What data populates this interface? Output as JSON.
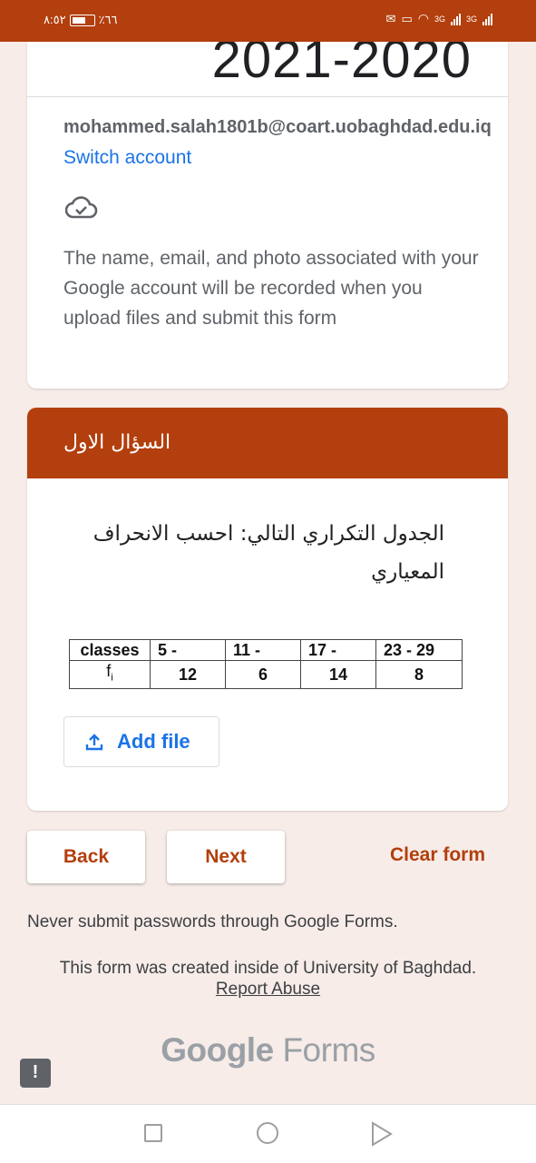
{
  "status_bar": {
    "time": "٨:٥٢",
    "battery_percent": "٪٦٦",
    "network_label_1": "3G",
    "network_label_2": "3G"
  },
  "header_card": {
    "year_title": "2021-2020",
    "account_email": "mohammed.salah1801b@coart.uobaghdad.edu.iq",
    "switch_account": "Switch account",
    "notice": "The name, email, and photo associated with your Google account will be recorded when you upload files and submit this form"
  },
  "question_card": {
    "section_title": "السؤال الاول",
    "question_text": "الجدول التكراري التالي: احسب الانحراف المعياري",
    "table": {
      "row1": [
        "classes",
        "5 -",
        "11 -",
        "17 -",
        "23 - 29"
      ],
      "row2_label": "f",
      "row2_sub": "i",
      "row2": [
        "12",
        "6",
        "14",
        "8"
      ]
    },
    "add_file_label": "Add file"
  },
  "actions": {
    "back": "Back",
    "next": "Next",
    "clear": "Clear form"
  },
  "footer": {
    "password_note": "Never submit passwords through Google Forms.",
    "created_note": "This form was created inside of University of Baghdad.",
    "report_abuse": "Report Abuse",
    "brand_google": "Google",
    "brand_forms": "Forms"
  },
  "colors": {
    "theme": "#b23f0d",
    "background": "#f7ece8",
    "link": "#1a73e8"
  },
  "icons": [
    "cloud-check-icon",
    "upload-icon",
    "feedback-icon",
    "nav-recents-icon",
    "nav-home-icon",
    "nav-back-icon"
  ]
}
